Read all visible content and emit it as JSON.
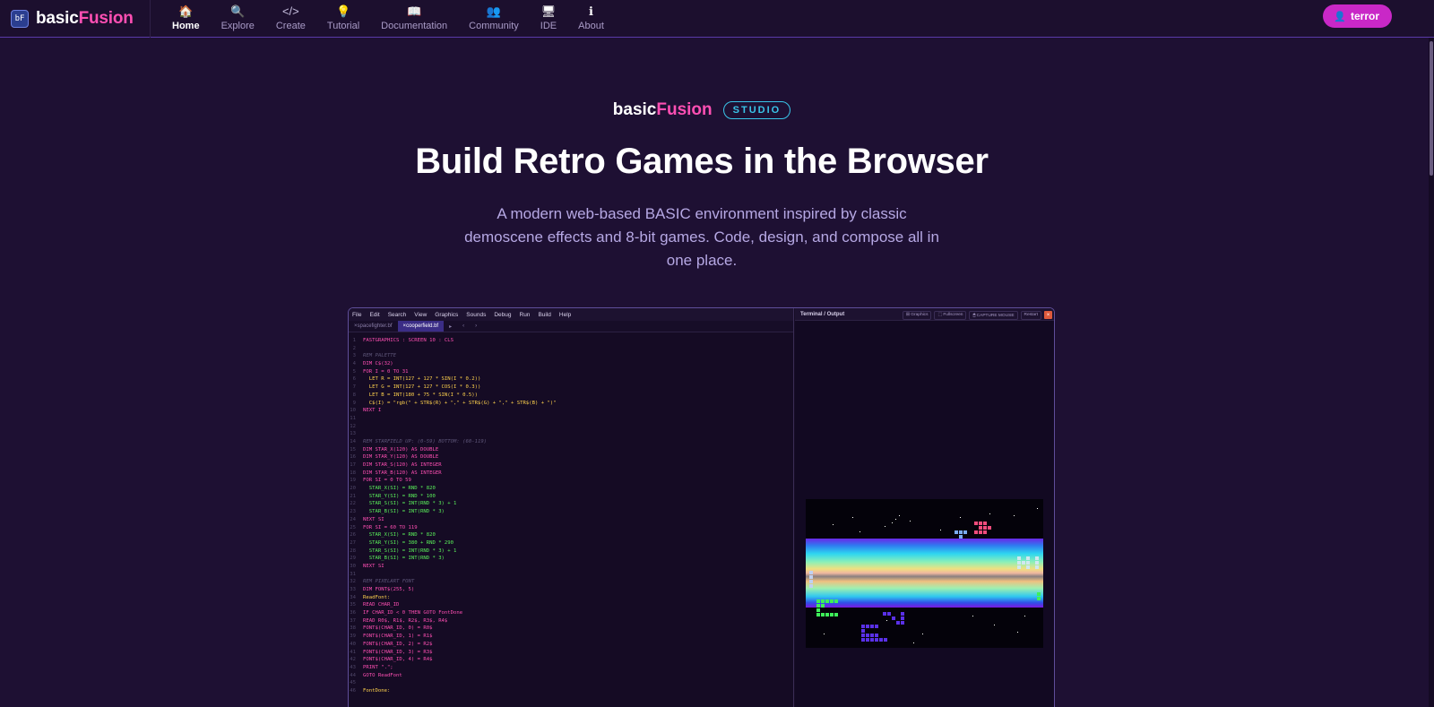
{
  "nav": {
    "logo_prefix": "basic",
    "logo_suffix": "Fusion",
    "logo_badge": "bF",
    "items": [
      {
        "label": "Home",
        "icon": "house-icon",
        "glyph": "🏠",
        "active": true
      },
      {
        "label": "Explore",
        "icon": "search-icon",
        "glyph": "🔍",
        "active": false
      },
      {
        "label": "Create",
        "icon": "code-icon",
        "glyph": "</>",
        "active": false
      },
      {
        "label": "Tutorial",
        "icon": "lightbulb-icon",
        "glyph": "💡",
        "active": false
      },
      {
        "label": "Documentation",
        "icon": "book-icon",
        "glyph": "📖",
        "active": false
      },
      {
        "label": "Community",
        "icon": "people-icon",
        "glyph": "👥",
        "active": false
      },
      {
        "label": "IDE",
        "icon": "monitor-icon",
        "glyph": "🖥",
        "active": false
      },
      {
        "label": "About",
        "icon": "info-icon",
        "glyph": "ℹ",
        "active": false
      }
    ],
    "user": {
      "label": "terror",
      "icon": "user-icon"
    }
  },
  "hero": {
    "brand_prefix": "basic",
    "brand_suffix": "Fusion",
    "badge": "STUDIO",
    "title": "Build Retro Games in the Browser",
    "subtitle": "A modern web-based BASIC environment inspired by classic demoscene effects and 8-bit games. Code, design, and compose all in one place."
  },
  "ide": {
    "menu": [
      "File",
      "Edit",
      "Search",
      "View",
      "Graphics",
      "Sounds",
      "Debug",
      "Run",
      "Build",
      "Help"
    ],
    "tabs": [
      {
        "label": "spacefighter.bf",
        "active": false
      },
      {
        "label": "cooperfield.bf",
        "active": true
      }
    ],
    "tab_controls": [
      "▸",
      "‹",
      "›"
    ],
    "terminal": {
      "title": "Terminal / Output",
      "buttons": [
        "⊞ Graphics",
        "⬚ Fullscreen",
        "🖱 CAPTURE MOUSE",
        "Restart"
      ],
      "close": "×"
    },
    "code": [
      {
        "n": "1",
        "t": "FASTGRAPHICS : SCREEN 10 : CLS",
        "c": "kw"
      },
      {
        "n": "2",
        "t": "",
        "c": "ct"
      },
      {
        "n": "3",
        "t": "REM PALETTE",
        "c": "cm"
      },
      {
        "n": "4",
        "t": "DIM C$(32)",
        "c": "kw"
      },
      {
        "n": "5",
        "t": "FOR I = 0 TO 31",
        "c": "kw"
      },
      {
        "n": "6",
        "t": "  LET R = INT(127 + 127 * SIN(I * 0.2))",
        "c": "str"
      },
      {
        "n": "7",
        "t": "  LET G = INT(127 + 127 * COS(I * 0.3))",
        "c": "str"
      },
      {
        "n": "8",
        "t": "  LET B = INT(180 + 75 * SIN(I * 0.5))",
        "c": "str"
      },
      {
        "n": "9",
        "t": "  C$(I) = \"rgb(\" + STR$(R) + \",\" + STR$(G) + \",\" + STR$(B) + \")\"",
        "c": "str"
      },
      {
        "n": "10",
        "t": "NEXT I",
        "c": "kw"
      },
      {
        "n": "11",
        "t": "",
        "c": "ct"
      },
      {
        "n": "12",
        "t": "",
        "c": "ct"
      },
      {
        "n": "13",
        "t": "",
        "c": "ct"
      },
      {
        "n": "14",
        "t": "REM STARFIELD UP: (0-59) BOTTOM: (60-119)",
        "c": "cm"
      },
      {
        "n": "15",
        "t": "DIM STAR_X(120) AS DOUBLE",
        "c": "kw"
      },
      {
        "n": "16",
        "t": "DIM STAR_Y(120) AS DOUBLE",
        "c": "kw"
      },
      {
        "n": "17",
        "t": "DIM STAR_S(120) AS INTEGER",
        "c": "kw"
      },
      {
        "n": "18",
        "t": "DIM STAR_B(120) AS INTEGER",
        "c": "kw"
      },
      {
        "n": "19",
        "t": "FOR SI = 0 TO 59",
        "c": "kw"
      },
      {
        "n": "20",
        "t": "  STAR_X(SI) = RND * 820",
        "c": "num"
      },
      {
        "n": "21",
        "t": "  STAR_Y(SI) = RND * 100",
        "c": "num"
      },
      {
        "n": "22",
        "t": "  STAR_S(SI) = INT(RND * 3) + 1",
        "c": "num"
      },
      {
        "n": "23",
        "t": "  STAR_B(SI) = INT(RND * 3)",
        "c": "num"
      },
      {
        "n": "24",
        "t": "NEXT SI",
        "c": "kw"
      },
      {
        "n": "25",
        "t": "FOR SI = 60 TO 119",
        "c": "kw"
      },
      {
        "n": "26",
        "t": "  STAR_X(SI) = RND * 820",
        "c": "num"
      },
      {
        "n": "27",
        "t": "  STAR_Y(SI) = 380 + RND * 290",
        "c": "num"
      },
      {
        "n": "28",
        "t": "  STAR_S(SI) = INT(RND * 3) + 1",
        "c": "num"
      },
      {
        "n": "29",
        "t": "  STAR_B(SI) = INT(RND * 3)",
        "c": "num"
      },
      {
        "n": "30",
        "t": "NEXT SI",
        "c": "kw"
      },
      {
        "n": "31",
        "t": "",
        "c": "ct"
      },
      {
        "n": "32",
        "t": "REM PIXELART FONT",
        "c": "cm"
      },
      {
        "n": "33",
        "t": "DIM FONT$(255, 5)",
        "c": "kw"
      },
      {
        "n": "34",
        "t": "ReadFont:",
        "c": "str"
      },
      {
        "n": "35",
        "t": "READ CHAR_ID",
        "c": "kw"
      },
      {
        "n": "36",
        "t": "IF CHAR_ID < 0 THEN GOTO FontDone",
        "c": "kw"
      },
      {
        "n": "37",
        "t": "READ R0$, R1$, R2$, R3$, R4$",
        "c": "kw"
      },
      {
        "n": "38",
        "t": "FONT$(CHAR_ID, 0) = R0$",
        "c": "kw"
      },
      {
        "n": "39",
        "t": "FONT$(CHAR_ID, 1) = R1$",
        "c": "kw"
      },
      {
        "n": "40",
        "t": "FONT$(CHAR_ID, 2) = R2$",
        "c": "kw"
      },
      {
        "n": "41",
        "t": "FONT$(CHAR_ID, 3) = R3$",
        "c": "kw"
      },
      {
        "n": "42",
        "t": "FONT$(CHAR_ID, 4) = R4$",
        "c": "kw"
      },
      {
        "n": "43",
        "t": "PRINT \".\";",
        "c": "kw"
      },
      {
        "n": "44",
        "t": "GOTO ReadFont",
        "c": "kw"
      },
      {
        "n": "45",
        "t": "",
        "c": "ct"
      },
      {
        "n": "46",
        "t": "FontDone:",
        "c": "str"
      }
    ]
  },
  "colors": {
    "background": "#1e1033",
    "accent_pink": "#ff4fb3",
    "accent_cyan": "#39c4e8",
    "user_button": "#c928c7"
  }
}
